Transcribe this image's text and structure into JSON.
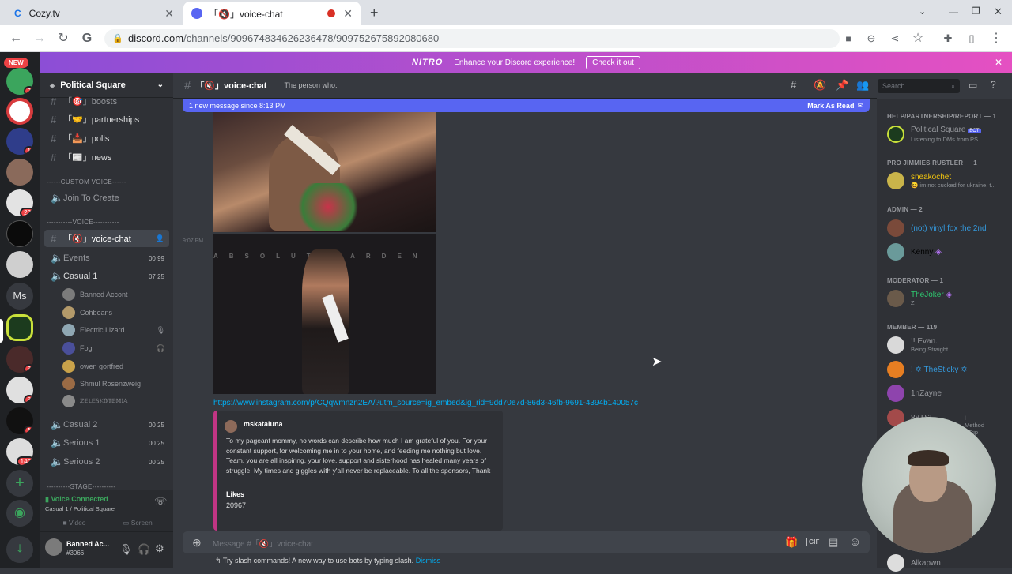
{
  "browser": {
    "tabs": [
      {
        "title": "Cozy.tv"
      },
      {
        "title": "「🔇」voice-chat"
      }
    ],
    "new_tab": "+",
    "url_domain": "discord.com",
    "url_path": "/channels/909674834626236478/909752675892080680"
  },
  "nitro": {
    "logo": "NITRO",
    "message": "Enhance your Discord experience!",
    "cta": "Check it out"
  },
  "guilds": {
    "new_badge": "NEW",
    "items": [
      {
        "badge": "2"
      },
      {
        "badge": ""
      },
      {
        "badge": "1"
      },
      {
        "badge": ""
      },
      {
        "badge": "23"
      },
      {
        "badge": ""
      },
      {
        "badge": ""
      },
      {
        "label": "Ms"
      },
      {
        "badge": ""
      },
      {
        "badge": "3"
      },
      {
        "badge": "3"
      },
      {
        "badge": "1"
      },
      {
        "badge": "140"
      }
    ]
  },
  "server": {
    "name": "Political Square",
    "channels": [
      {
        "label": "「🎯」boosts"
      },
      {
        "label": "「🤝」partnerships"
      },
      {
        "label": "「📥」polls"
      },
      {
        "label": "「📰」news"
      }
    ],
    "cat_custom": "------CUSTOM VOICE------",
    "join_create": "Join To Create",
    "cat_voice": "-----------VOICE-----------",
    "voice_chat": "「🔇」voice-chat",
    "events": {
      "label": "Events",
      "a": "00",
      "b": "99"
    },
    "casual1": {
      "label": "Casual 1",
      "a": "07",
      "b": "25"
    },
    "voice_users": [
      "Banned Accont",
      "Cohbeans",
      "Electric Lizard",
      "Fog",
      "owen gortfred",
      "Shmul Rosenzweig",
      "ℤ𝔼𝕃𝔼𝕊𝕂𝕆𝕋𝔼𝕄𝕀𝔸"
    ],
    "casual2": {
      "label": "Casual 2",
      "a": "00",
      "b": "25"
    },
    "serious1": {
      "label": "Serious 1",
      "a": "00",
      "b": "25"
    },
    "serious2": {
      "label": "Serious 2",
      "a": "00",
      "b": "25"
    },
    "cat_stage": "----------STAGE----------"
  },
  "voice_panel": {
    "status": "Voice Connected",
    "location": "Casual 1 / Political Square",
    "video": "Video",
    "screen": "Screen"
  },
  "user_panel": {
    "name": "Banned Ac...",
    "tag": "#3066"
  },
  "chat": {
    "channel": "「🔇」voice-chat",
    "topic": "The person who.",
    "search_placeholder": "Search",
    "new_messages": "1 new message since 8:13 PM",
    "mark_read": "Mark As Read",
    "timestamp": "9:07 PM",
    "link": "https://www.instagram.com/p/CQqwmnzn2EA/?utm_source=ig_embed&ig_rid=9dd70e7d-86d3-46fb-9691-4394b140057c",
    "embed": {
      "author": "mskataluna",
      "description": "To my pageant mommy, no words can describe how much I am grateful of you. For your constant support, for welcoming me in to your home, and feeding me nothing but love. Team, you are all inspiring. your love, support and sisterhood has healed many years of struggle. My times and giggles with y'all never be replaceable. To all the sponsors, Thank ...",
      "field_label": "Likes",
      "field_value": "20967"
    },
    "input_placeholder": "Message #「🔇」voice-chat",
    "tip": "Try slash commands! A new way to use bots by typing slash.",
    "dismiss": "Dismiss"
  },
  "members": {
    "cat1": "HELP/PARTNERSHIP/REPORT — 1",
    "ps_name": "Political Square",
    "ps_bot": "BOT",
    "ps_status": "Listening to DMs from PS",
    "cat2": "PRO JIMMIES RUSTLER — 1",
    "sneak_name": "sneakochet",
    "sneak_status": "😆 im not cucked for ukraine, t...",
    "cat3": "ADMIN — 2",
    "admin1": "(not) vinyl fox the 2nd",
    "admin2": "Kenny",
    "cat4": "MODERATOR — 1",
    "mod1": "TheJoker",
    "mod1_status": "Z",
    "cat5": "MEMBER — 119",
    "m1": "!! Evan.",
    "m1_status": "Being Straight",
    "m2": "! ✡ TheSticky ✡",
    "m3": "1nZayne",
    "m4": "88TSI",
    "m4_status": "l Method - Trip ...",
    "m5": "Alkapwn"
  },
  "colors": {
    "blurple": "#5865f2",
    "online": "#3ba55d",
    "link": "#00aff4",
    "instagram": "#c13584"
  }
}
